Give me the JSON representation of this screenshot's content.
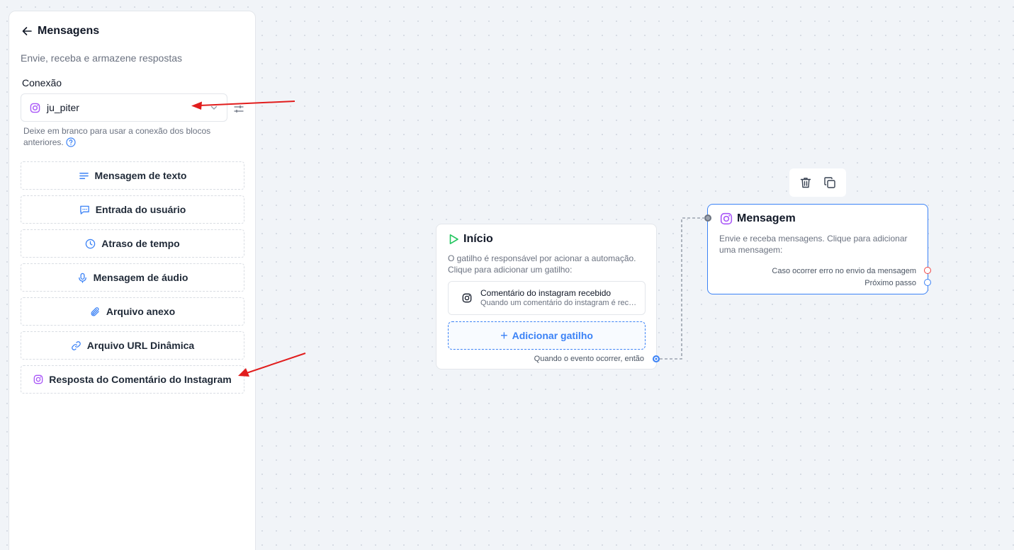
{
  "sidebar": {
    "title": "Mensagens",
    "subtitle": "Envie, receba e armazene respostas",
    "connection_label": "Conexão",
    "connection_value": "ju_piter",
    "hint": "Deixe em branco para usar a conexão dos blocos anteriores.",
    "options": [
      {
        "label": "Mensagem de texto",
        "icon": "text-lines-icon"
      },
      {
        "label": "Entrada do usuário",
        "icon": "chat-input-icon"
      },
      {
        "label": "Atraso de tempo",
        "icon": "clock-icon"
      },
      {
        "label": "Mensagem de áudio",
        "icon": "microphone-icon"
      },
      {
        "label": "Arquivo anexo",
        "icon": "paperclip-icon"
      },
      {
        "label": "Arquivo URL Dinâmica",
        "icon": "link-icon"
      },
      {
        "label": "Resposta do Comentário do Instagram",
        "icon": "instagram-icon"
      }
    ]
  },
  "start_node": {
    "title": "Início",
    "description": "O gatilho é responsável por acionar a automação. Clique para adicionar um gatilho:",
    "trigger": {
      "title": "Comentário do instagram recebido",
      "subtitle": "Quando um comentário do instagram é recebido"
    },
    "add_trigger": "Adicionar gatilho",
    "output_label": "Quando o evento ocorrer, então"
  },
  "message_node": {
    "title": "Mensagem",
    "description": "Envie e receba mensagens. Clique para adicionar uma mensagem:",
    "error_output": "Caso ocorrer erro no envio da mensagem",
    "next_output": "Próximo passo"
  },
  "colors": {
    "accent": "#3b82f6",
    "instagram": "#a855f7",
    "play": "#22c55e",
    "error_port": "#ef4444",
    "annotation_arrow": "#e11d1d"
  }
}
